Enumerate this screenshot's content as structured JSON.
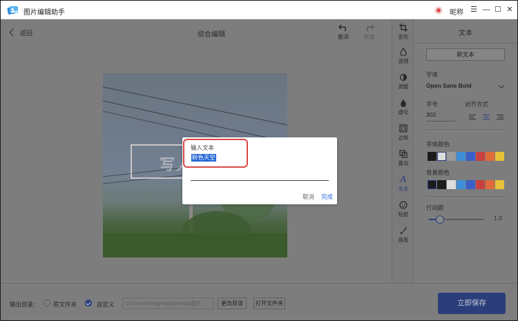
{
  "app": {
    "title": "图片编辑助手",
    "nickname": "昵称"
  },
  "window": {
    "menu": "☰",
    "minimize": "—",
    "maximize": "☐",
    "close": "✕"
  },
  "toolbar": {
    "back": "返回",
    "title": "综合编辑",
    "undo": "撤消",
    "redo": "恢复"
  },
  "canvas": {
    "watermark": "写人"
  },
  "tools": [
    {
      "label": "变形",
      "icon": "crop-icon"
    },
    {
      "label": "滤镜",
      "icon": "filter-icon"
    },
    {
      "label": "调整",
      "icon": "adjust-icon"
    },
    {
      "label": "虚化",
      "icon": "blur-icon"
    },
    {
      "label": "边框",
      "icon": "border-icon"
    },
    {
      "label": "叠加",
      "icon": "overlay-icon"
    },
    {
      "label": "文本",
      "icon": "text-icon",
      "active": true
    },
    {
      "label": "贴纸",
      "icon": "sticker-icon"
    },
    {
      "label": "画笔",
      "icon": "brush-icon"
    }
  ],
  "panel": {
    "title": "文本",
    "new_text": "新文本",
    "font_label": "字体",
    "font_value": "Open Sans Bold",
    "size_label": "字号",
    "size_value": "302",
    "align_label": "对齐方式",
    "font_color_label": "字体颜色",
    "bg_color_label": "背景颜色",
    "spacing_label": "行间距",
    "spacing_value": "1.0",
    "spacing_level": 0.1,
    "font_colors": [
      "#1c1c1c",
      "#dcdcdc",
      "#9a9a9a",
      "#3f8fd8",
      "#3a5fc8",
      "#c84040",
      "#e06a3a",
      "#e8c23a"
    ],
    "bg_colors": [
      "#1c1c1c",
      "#1c1c1c",
      "#dcdcdc",
      "#3f8fd8",
      "#3a5fc8",
      "#c84040",
      "#e06a3a",
      "#e8c23a"
    ]
  },
  "bottom": {
    "output_label": "输出目录：",
    "source_folder": "原文件夹",
    "custom": "自定义",
    "path": "C:\\Users\\FengPing\\Desktop\\图片",
    "change_dir": "更改目录",
    "open_folder": "打开文件夹",
    "save": "立即保存"
  },
  "dialog": {
    "title": "输入文本",
    "value": "粉色天空",
    "cancel": "取消",
    "ok": "完成"
  }
}
